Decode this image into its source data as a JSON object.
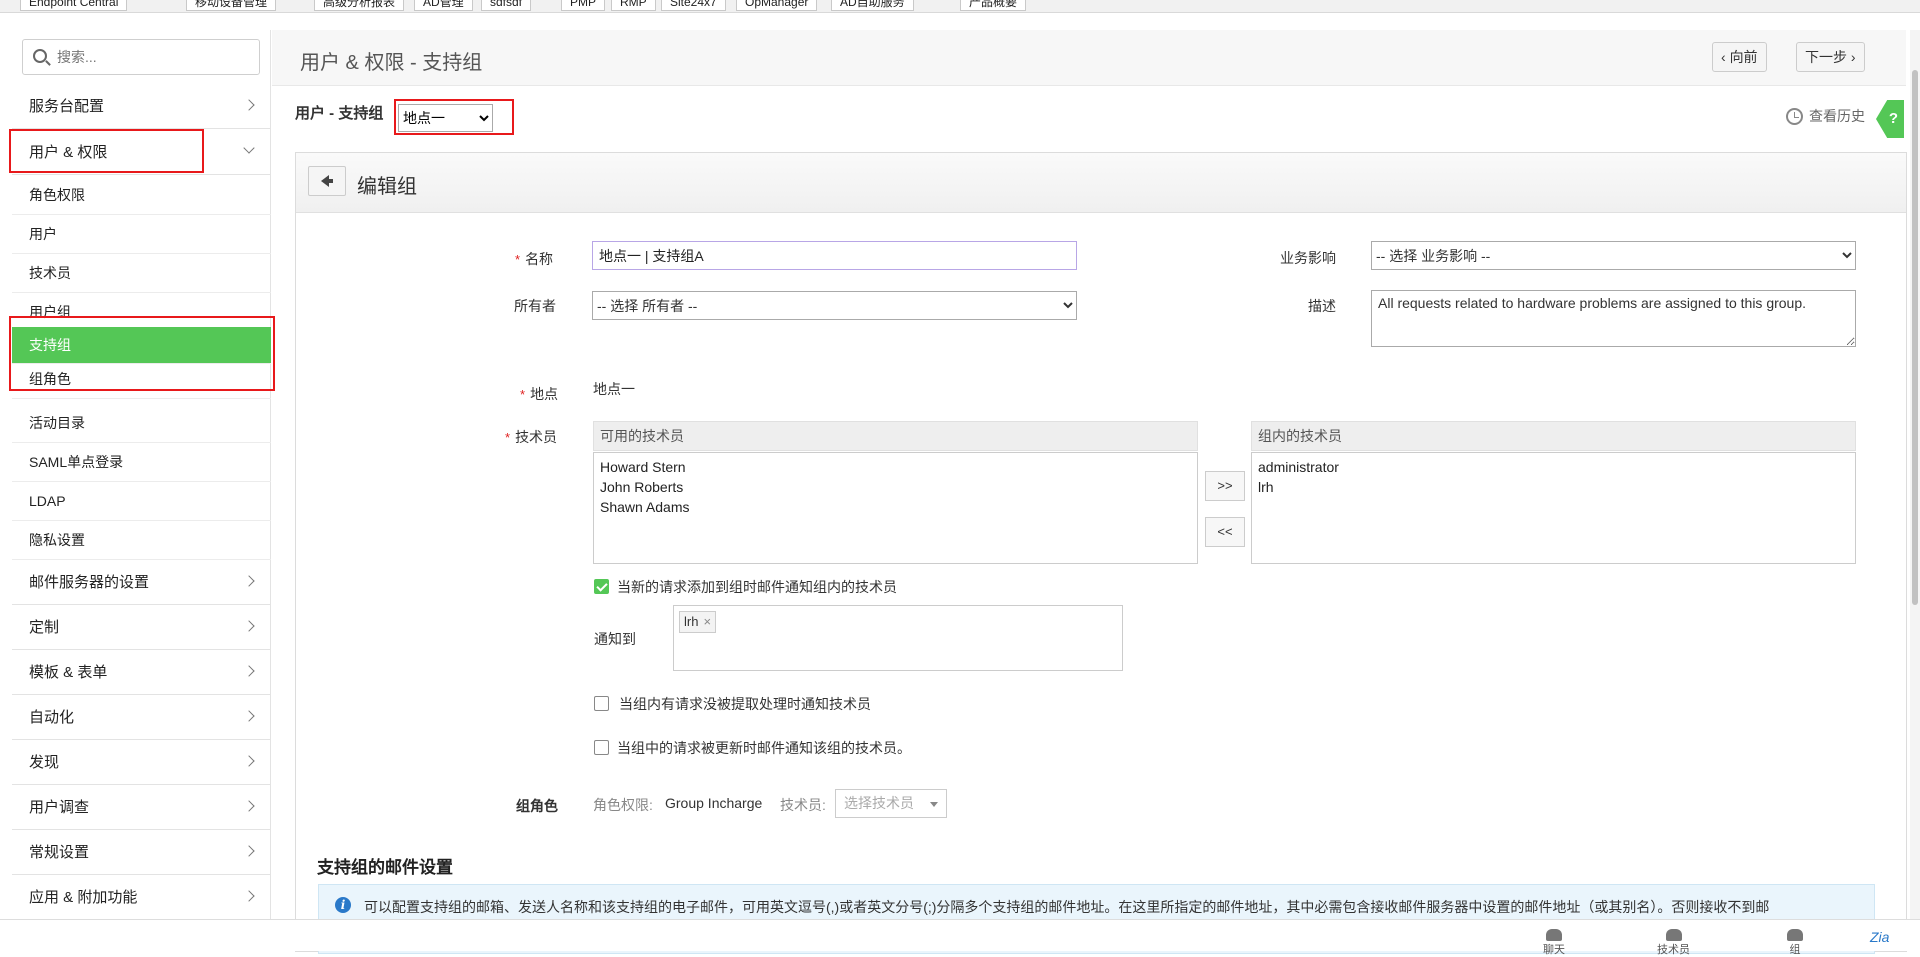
{
  "bookmarks": [
    "Endpoint Central",
    "移动设备管理",
    "高级分析报表",
    "AD管理",
    "sdfsdf",
    "PMP",
    "RMP",
    "Site24x7",
    "OpManager",
    "AD自助服务",
    "产品概要"
  ],
  "sidebar": {
    "search_placeholder": "搜索...",
    "sections": [
      {
        "label": "服务台配置"
      },
      {
        "label": "用户 & 权限"
      }
    ],
    "items": [
      {
        "label": "角色权限"
      },
      {
        "label": "用户"
      },
      {
        "label": "技术员"
      },
      {
        "label": "用户组"
      },
      {
        "label": "支持组"
      },
      {
        "label": "组角色"
      },
      {
        "label": "活动目录"
      },
      {
        "label": "SAML单点登录"
      },
      {
        "label": "LDAP"
      },
      {
        "label": "隐私设置"
      }
    ],
    "more_sections": [
      {
        "label": "邮件服务器的设置"
      },
      {
        "label": "定制"
      },
      {
        "label": "模板 & 表单"
      },
      {
        "label": "自动化"
      },
      {
        "label": "发现"
      },
      {
        "label": "用户调查"
      },
      {
        "label": "常规设置"
      },
      {
        "label": "应用 & 附加功能"
      }
    ]
  },
  "header": {
    "title": "用户 & 权限 - 支持组",
    "prev_label": "向前",
    "next_label": "下一步"
  },
  "subheader": {
    "label": "用户 - 支持组",
    "site_value": "地点一",
    "history_label": "查看历史",
    "help_label": "?"
  },
  "panel": {
    "title": "编辑组",
    "name_label": "名称",
    "name_value": "地点一 | 支持组A",
    "owner_label": "所有者",
    "owner_value": "-- 选择 所有者 --",
    "impact_label": "业务影响",
    "impact_value": "-- 选择 业务影响 --",
    "desc_label": "描述",
    "desc_value": "All requests related to hardware problems are assigned to this group.",
    "site_label": "地点",
    "site_value": "地点一",
    "tech_label": "技术员",
    "available_header": "可用的技术员",
    "available": [
      "Howard Stern",
      "John Roberts",
      "Shawn Adams"
    ],
    "ingroup_header": "组内的技术员",
    "ingroup": [
      "administrator",
      "lrh"
    ],
    "add_btn": ">>",
    "remove_btn": "<<",
    "notify_new_label": "当新的请求添加到组时邮件通知组内的技术员",
    "notify_to_label": "通知到",
    "notify_tag": "lrh",
    "notify_unpicked_label": "当组内有请求没被提取处理时通知技术员",
    "notify_unpicked_checked": false,
    "notify_updated_label": "当组中的请求被更新时邮件通知该组的技术员。",
    "notify_updated_checked": false,
    "notify_new_checked": true,
    "group_role_label": "组角色",
    "role_perm_label": "角色权限:",
    "role_perm_value": "Group Incharge",
    "role_tech_label": "技术员:",
    "role_tech_placeholder": "选择技术员",
    "mail_section_title": "支持组的邮件设置",
    "info_text": "可以配置支持组的邮箱、发送人名称和该支持组的电子邮件，可用英文逗号(,)或者英文分号(;)分隔多个支持组的邮件地址。在这里所指定的邮件地址，其中必需包含接收邮件服务器中设置的邮件地址（或其别名）。否则接收不到邮"
  },
  "bottombar": {
    "chat": "聊天",
    "tech": "技术员",
    "group": "组"
  },
  "colors": {
    "accent_green": "#54c756",
    "highlight_red": "#e8191b"
  }
}
